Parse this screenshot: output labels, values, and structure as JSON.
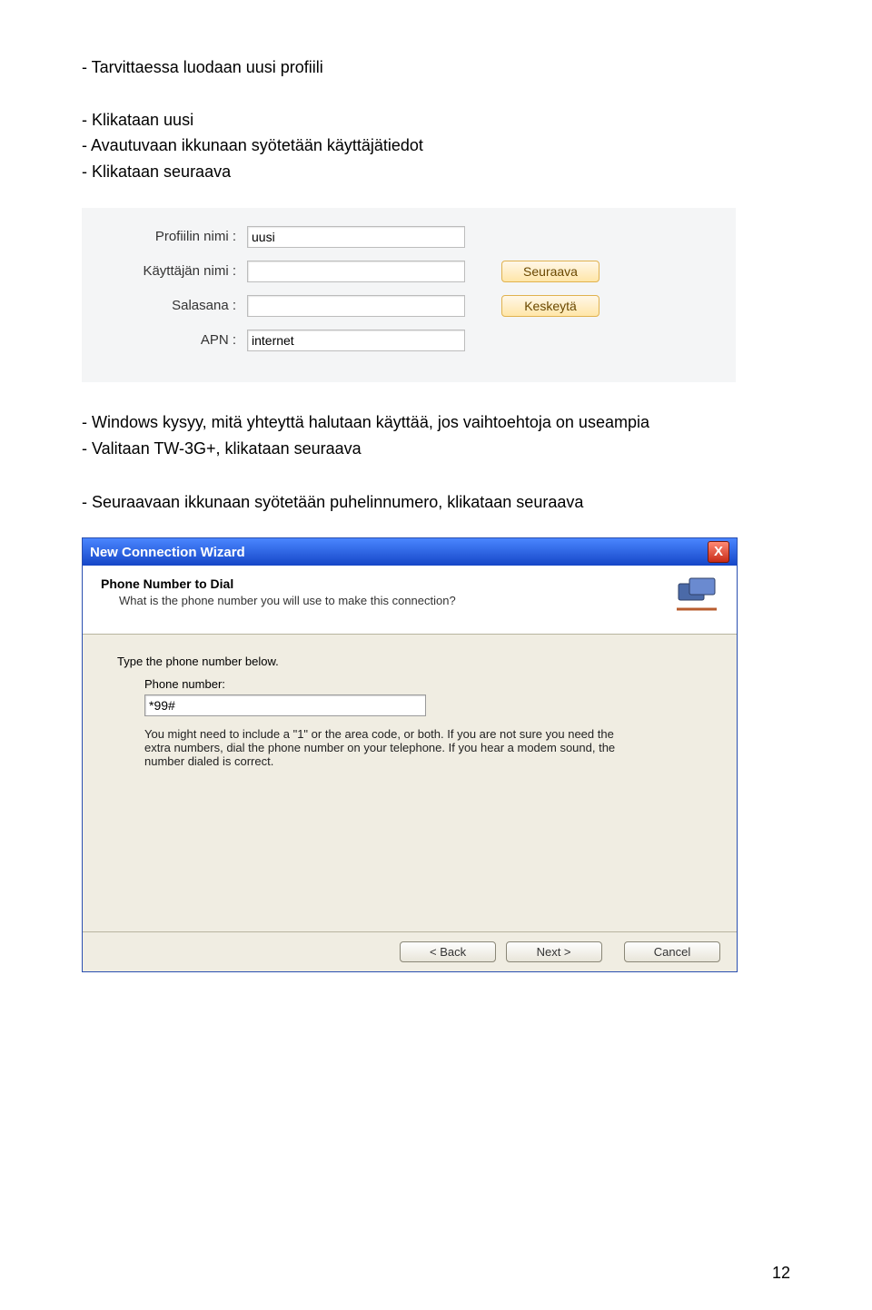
{
  "section1": {
    "bullets": [
      "- Tarvittaessa luodaan uusi profiili",
      "- Klikataan uusi",
      "- Avautuvaan ikkunaan syötetään käyttäjätiedot",
      "- Klikataan seuraava"
    ]
  },
  "profile_panel": {
    "labels": {
      "profile_name": "Profiilin nimi :",
      "username": "Käyttäjän nimi :",
      "password": "Salasana :",
      "apn": "APN :"
    },
    "values": {
      "profile_name": "uusi",
      "username": "",
      "password": "",
      "apn": "internet"
    },
    "buttons": {
      "next": "Seuraava",
      "cancel": "Keskeytä"
    }
  },
  "section2": {
    "bullets": [
      "- Windows kysyy, mitä yhteyttä halutaan käyttää, jos vaihtoehtoja on useampia",
      "- Valitaan TW-3G+, klikataan seuraava"
    ]
  },
  "section3": {
    "bullets": [
      "- Seuraavaan ikkunaan syötetään puhelinnumero, klikataan seuraava"
    ]
  },
  "wizard": {
    "window_title": "New Connection Wizard",
    "header_title": "Phone Number to Dial",
    "header_sub": "What is the phone number you will use to make this connection?",
    "intro": "Type the phone number below.",
    "field_label": "Phone number:",
    "phone_value": "*99#",
    "hint": "You might need to include a \"1\" or the area code, or both. If you are not sure you need the extra numbers, dial the phone number on your telephone. If you hear a modem sound, the number dialed is correct.",
    "buttons": {
      "back": "< Back",
      "next": "Next >",
      "cancel": "Cancel"
    },
    "close_glyph": "X"
  },
  "page_number": "12"
}
